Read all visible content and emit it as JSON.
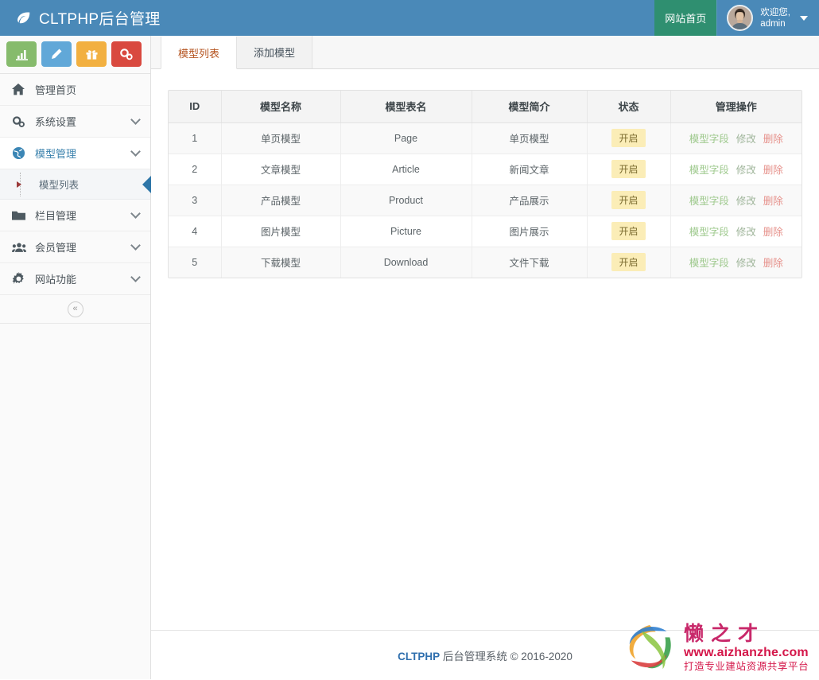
{
  "header": {
    "logo_icon": "leaf-icon",
    "title": "CLTPHP后台管理",
    "home_button": "网站首页",
    "user_greeting": "欢迎您,",
    "user_name": "admin",
    "brand_color": "#4a89b8",
    "home_button_color": "#2f8f70"
  },
  "quick_actions": [
    {
      "name": "chart-button",
      "icon": "bar-chart-icon",
      "color": "#86bb6c"
    },
    {
      "name": "edit-button",
      "icon": "pencil-icon",
      "color": "#61a8d8"
    },
    {
      "name": "gift-button",
      "icon": "gift-icon",
      "color": "#f2b040"
    },
    {
      "name": "settings-button",
      "icon": "cogs-icon",
      "color": "#d9493f"
    }
  ],
  "sidebar": {
    "items": [
      {
        "label": "管理首页",
        "icon": "home-icon",
        "has_chevron": false,
        "active": false
      },
      {
        "label": "系统设置",
        "icon": "cogs-icon",
        "has_chevron": true,
        "active": false
      },
      {
        "label": "模型管理",
        "icon": "globe-icon",
        "has_chevron": true,
        "active": true
      },
      {
        "label": "栏目管理",
        "icon": "folder-icon",
        "has_chevron": true,
        "active": false
      },
      {
        "label": "会员管理",
        "icon": "users-icon",
        "has_chevron": true,
        "active": false
      },
      {
        "label": "网站功能",
        "icon": "gear-icon",
        "has_chevron": true,
        "active": false
      }
    ],
    "submenu": {
      "label": "模型列表",
      "parent_index": 2,
      "active": true
    },
    "collapse_label": "«"
  },
  "tabs": [
    {
      "label": "模型列表",
      "active": true
    },
    {
      "label": "添加模型",
      "active": false
    }
  ],
  "table": {
    "columns": [
      "ID",
      "模型名称",
      "模型表名",
      "模型简介",
      "状态",
      "管理操作"
    ],
    "rows": [
      {
        "id": "1",
        "name": "单页模型",
        "table_name": "Page",
        "desc": "单页模型",
        "status": "开启",
        "ops": [
          "模型字段",
          "修改",
          "删除"
        ]
      },
      {
        "id": "2",
        "name": "文章模型",
        "table_name": "Article",
        "desc": "新闻文章",
        "status": "开启",
        "ops": [
          "模型字段",
          "修改",
          "删除"
        ]
      },
      {
        "id": "3",
        "name": "产品模型",
        "table_name": "Product",
        "desc": "产品展示",
        "status": "开启",
        "ops": [
          "模型字段",
          "修改",
          "删除"
        ]
      },
      {
        "id": "4",
        "name": "图片模型",
        "table_name": "Picture",
        "desc": "图片展示",
        "status": "开启",
        "ops": [
          "模型字段",
          "修改",
          "删除"
        ]
      },
      {
        "id": "5",
        "name": "下载模型",
        "table_name": "Download",
        "desc": "文件下载",
        "status": "开启",
        "ops": [
          "模型字段",
          "修改",
          "删除"
        ]
      }
    ]
  },
  "footer": {
    "brand": "CLTPHP",
    "text": " 后台管理系统 © 2016-2020"
  },
  "watermark": {
    "cn_name": "懒之才",
    "url": "www.aizhanzhe.com",
    "slogan": "打造专业建站资源共享平台"
  }
}
